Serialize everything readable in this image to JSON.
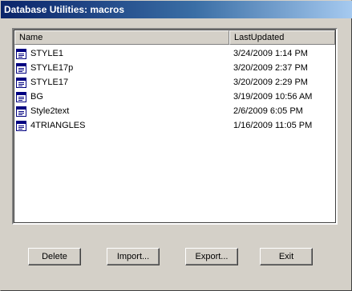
{
  "window": {
    "title": "Database Utilities: macros"
  },
  "list": {
    "columns": [
      "Name",
      "LastUpdated"
    ],
    "rows": [
      {
        "name": "STYLE1",
        "last_updated": "3/24/2009 1:14 PM"
      },
      {
        "name": "STYLE17p",
        "last_updated": "3/20/2009 2:37 PM"
      },
      {
        "name": "STYLE17",
        "last_updated": "3/20/2009 2:29 PM"
      },
      {
        "name": "BG",
        "last_updated": "3/19/2009 10:56 AM"
      },
      {
        "name": "Style2text",
        "last_updated": "2/6/2009 6:05 PM"
      },
      {
        "name": "4TRIANGLES",
        "last_updated": "1/16/2009 11:05 PM"
      }
    ],
    "row_icon": "macro-document-icon"
  },
  "buttons": {
    "delete": "Delete",
    "import": "Import...",
    "export": "Export...",
    "exit": "Exit"
  },
  "colors": {
    "titlebar_start": "#0a246a",
    "titlebar_end": "#a6caf0",
    "dialog_bg": "#d4d0c8"
  }
}
